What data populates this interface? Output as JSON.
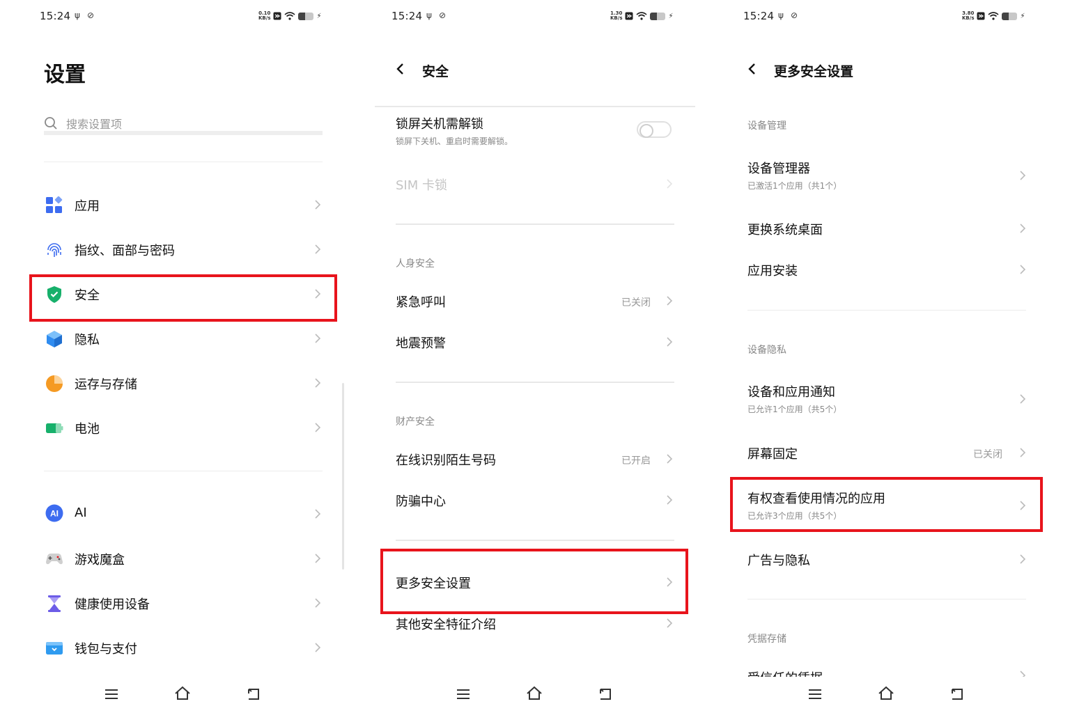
{
  "status": {
    "time": "15:24",
    "usb_glyph": "ψ",
    "sync_glyph": "⊘",
    "speeds": [
      {
        "value": "0.10",
        "unit": "KB/s"
      },
      {
        "value": "1.30",
        "unit": "KB/s"
      },
      {
        "value": "3.80",
        "unit": "KB/s"
      }
    ]
  },
  "screen1": {
    "title": "设置",
    "search_placeholder": "搜索设置项",
    "group1": [
      "应用",
      "指纹、面部与密码",
      "安全",
      "隐私",
      "运存与存储",
      "电池"
    ],
    "group2": [
      "AI",
      "游戏魔盒",
      "健康使用设备",
      "钱包与支付"
    ],
    "ai_badge": "AI"
  },
  "screen2": {
    "title": "安全",
    "lock_title": "锁屏关机需解锁",
    "lock_sub": "锁屏下关机、重启时需要解锁。",
    "sim_lock": "SIM 卡锁",
    "section_personal": "人身安全",
    "emergency": "紧急呼叫",
    "emergency_status": "已关闭",
    "earthquake": "地震预警",
    "section_property": "财产安全",
    "online_id": "在线识别陌生号码",
    "online_id_status": "已开启",
    "anti_fraud": "防骗中心",
    "more_security": "更多安全设置",
    "other_features": "其他安全特征介绍"
  },
  "screen3": {
    "title": "更多安全设置",
    "section_device_mgmt": "设备管理",
    "device_manager": "设备管理器",
    "device_manager_sub": "已激活1个应用（共1个）",
    "change_launcher": "更换系统桌面",
    "app_install": "应用安装",
    "section_device_privacy": "设备隐私",
    "device_app_notif": "设备和应用通知",
    "device_app_notif_sub": "已允许1个应用（共5个）",
    "screen_pinning": "屏幕固定",
    "screen_pinning_status": "已关闭",
    "usage_access": "有权查看使用情况的应用",
    "usage_access_sub": "已允许3个应用（共5个）",
    "ads_privacy": "广告与隐私",
    "section_credential": "凭据存储",
    "trusted_credentials": "受信任的凭据"
  },
  "colors": {
    "highlight": "#e8141c",
    "apps_icon": "#3d6cf0",
    "fingerprint_icon": "#3d6cf0",
    "security_icon": "#17b06b",
    "privacy_icon": "#2f8cf0",
    "storage_icon": "#f59a23",
    "battery_icon": "#17b06b",
    "ai_icon": "#3d6cf0",
    "game_icon": "#777777",
    "health_icon": "#6c5ce7",
    "wallet_icon": "#2f9bf0"
  }
}
